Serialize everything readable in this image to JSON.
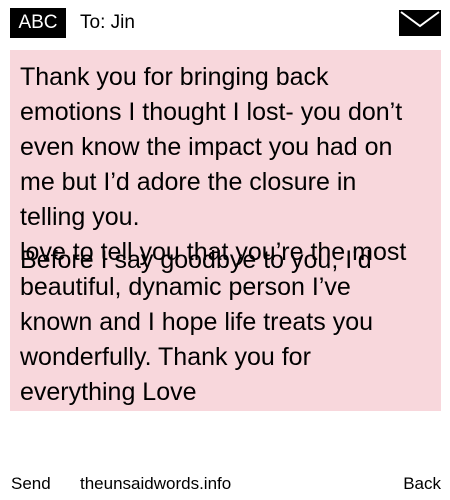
{
  "header": {
    "badge": "ABC",
    "to": "To: Jin",
    "icon": "envelope-icon"
  },
  "message": {
    "lines": [
      "Thank you for bringing back",
      "emotions I thought I lost- you don’t",
      "even know the impact you had on",
      "me but I’d adore the closure in",
      "telling you."
    ],
    "overlap_a": [
      "love to tell you that you’re the most",
      "beautiful, dynamic person I’ve"
    ],
    "overlap_b": [
      "Before I say goodbye to you, I’d"
    ],
    "tail": [
      "known and I hope life treats you",
      "wonderfully. Thank you for",
      "everything Love"
    ]
  },
  "footer": {
    "send": "Send",
    "site": "theunsaidwords.info",
    "back": "Back"
  },
  "colors": {
    "message_bg": "#f8d7dc",
    "badge_bg": "#000000"
  }
}
